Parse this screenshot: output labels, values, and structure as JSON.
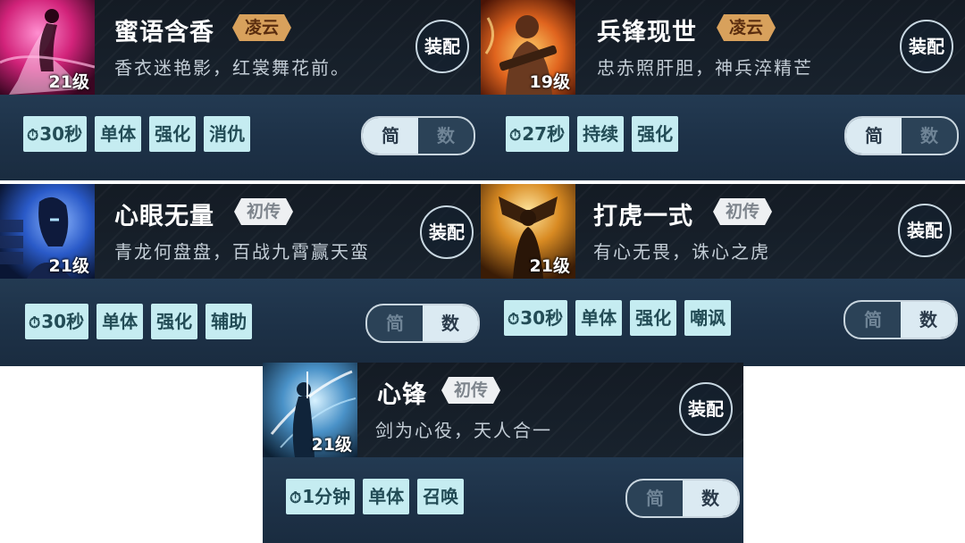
{
  "equip_label": "装配",
  "toggle": {
    "simple": "简",
    "numbers": "数"
  },
  "cards": [
    {
      "level": "21级",
      "name": "蜜语含香",
      "tag": "凌云",
      "description": "香衣迷艳影，红裳舞花前。",
      "cooldown": "30秒",
      "tags": [
        "单体",
        "强化",
        "消仇"
      ],
      "toggle_selected": "简",
      "portrait_icon": "dancer-portrait",
      "accent_color": "#e23a86"
    },
    {
      "level": "19级",
      "name": "兵锋现世",
      "tag": "凌云",
      "description": "忠赤照肝胆，神兵淬精芒",
      "cooldown": "27秒",
      "tags": [
        "持续",
        "强化"
      ],
      "toggle_selected": "简",
      "portrait_icon": "warrior-portrait",
      "accent_color": "#e0782a"
    },
    {
      "level": "21级",
      "name": "心眼无量",
      "tag": "初传",
      "description": "青龙何盘盘，百战九霄赢天蛮",
      "cooldown": "30秒",
      "tags": [
        "单体",
        "强化",
        "辅助"
      ],
      "toggle_selected": "数",
      "portrait_icon": "mage-portrait",
      "accent_color": "#3a6fd8"
    },
    {
      "level": "21级",
      "name": "打虎一式",
      "tag": "初传",
      "description": "有心无畏，诛心之虎",
      "cooldown": "30秒",
      "tags": [
        "单体",
        "强化",
        "嘲讽"
      ],
      "toggle_selected": "数",
      "portrait_icon": "brawler-portrait",
      "accent_color": "#e6a032"
    },
    {
      "level": "21级",
      "name": "心锋",
      "tag": "初传",
      "description": "剑为心役，天人合一",
      "cooldown": "1分钟",
      "tags": [
        "单体",
        "召唤"
      ],
      "toggle_selected": "数",
      "portrait_icon": "swordsman-portrait",
      "accent_color": "#6fb6e8"
    }
  ]
}
